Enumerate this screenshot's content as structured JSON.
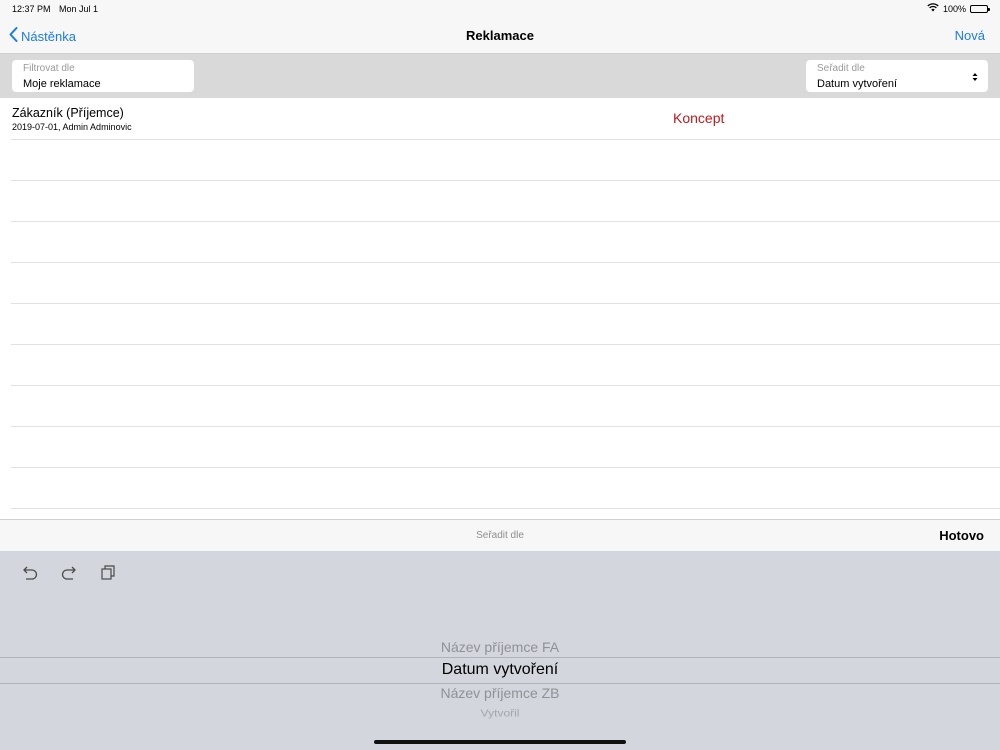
{
  "status_bar": {
    "time": "12:37 PM",
    "date": "Mon Jul 1",
    "battery_text": "100%",
    "battery_level": 1.0
  },
  "nav": {
    "back_label": "Nástěnka",
    "title": "Reklamace",
    "right_label": "Nová"
  },
  "filter": {
    "label": "Filtrovat dle",
    "value": "Moje reklamace"
  },
  "sort": {
    "label": "Seřadit dle",
    "value": "Datum vytvoření"
  },
  "list": {
    "items": [
      {
        "title": "Zákazník (Příjemce)",
        "subtitle": "2019-07-01, Admin Adminovic",
        "status": "Koncept"
      }
    ]
  },
  "picker_toolbar": {
    "title": "Seřadit dle",
    "done_label": "Hotovo"
  },
  "picker": {
    "options": [
      "Název příjemce FA",
      "Datum vytvoření",
      "Název příjemce ZB",
      "Vytvořil"
    ],
    "selected": "Datum vytvoření"
  },
  "colors": {
    "accent": "#1a7ce8",
    "status_red": "#c2181f",
    "picker_bg": "#d3d6dd"
  },
  "icons": {
    "back": "chevron-left-icon",
    "wifi": "wifi-icon",
    "battery": "battery-icon",
    "sort": "sort-arrows-icon",
    "undo": "undo-icon",
    "redo": "redo-icon",
    "paste": "paste-icon"
  }
}
